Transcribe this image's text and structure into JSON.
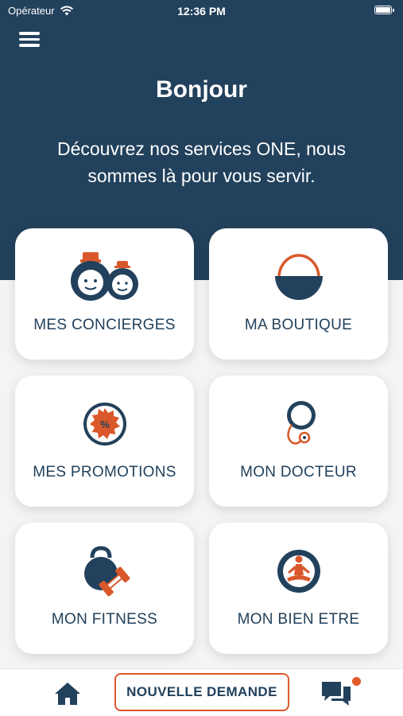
{
  "status_bar": {
    "carrier": "Opérateur",
    "time": "12:36 PM"
  },
  "header": {
    "greeting": "Bonjour",
    "subtitle": "Découvrez nos services ONE, nous sommes là pour vous servir."
  },
  "services": [
    {
      "label": "MES CONCIERGES",
      "icon": "concierges-icon"
    },
    {
      "label": "MA BOUTIQUE",
      "icon": "shopping-basket-icon"
    },
    {
      "label": "MES PROMOTIONS",
      "icon": "promotion-badge-icon"
    },
    {
      "label": "MON DOCTEUR",
      "icon": "stethoscope-icon"
    },
    {
      "label": "MON FITNESS",
      "icon": "kettlebell-icon"
    },
    {
      "label": "MON BIEN ETRE",
      "icon": "meditation-icon"
    }
  ],
  "bottom_nav": {
    "new_request_label": "NOUVELLE DEMANDE"
  },
  "colors": {
    "primary": "#22415c",
    "accent": "#d9582b",
    "background": "#f4f4f5"
  }
}
